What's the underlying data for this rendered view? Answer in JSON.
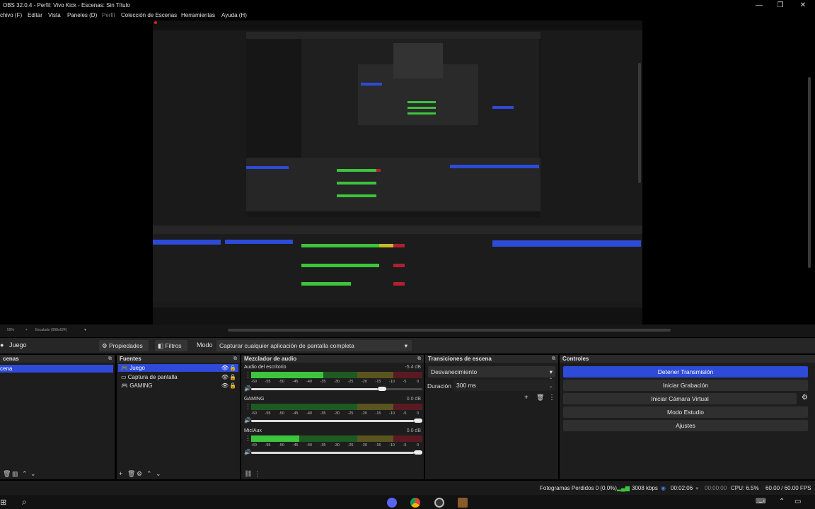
{
  "window": {
    "title": "OBS 32.0.4 - Perfil: Vivo Kick - Escenas: Sin Título",
    "minimize": "—",
    "maximize": "❐",
    "close": "✕"
  },
  "menu": {
    "items": [
      "chivo (F)",
      "Editar",
      "Vista",
      "Paneles (D)",
      "Perfil",
      "Colección de Escenas",
      "Herramientas",
      "Ayuda (H)"
    ]
  },
  "preview_bar": {
    "zoom": "59%",
    "scale": "Escalado (998x624)"
  },
  "context_bar": {
    "source_name": "Juego",
    "properties_label": "Propiedades",
    "filters_label": "Filtros",
    "mode_label": "Modo",
    "mode_value": "Capturar cualquier aplicación de pantalla completa"
  },
  "scenes": {
    "title": "cenas",
    "items": [
      {
        "label": "cena",
        "selected": true
      }
    ]
  },
  "sources": {
    "title": "Fuentes",
    "items": [
      {
        "label": "Juego",
        "icon": "gamepad-icon",
        "selected": true
      },
      {
        "label": "Captura de pantalla",
        "icon": "monitor-icon",
        "selected": false
      },
      {
        "label": "GAMING",
        "icon": "gamepad-icon",
        "selected": false
      }
    ]
  },
  "mixer": {
    "title": "Mezclador de audio",
    "ticks": [
      "-60",
      "-55",
      "-50",
      "-45",
      "-40",
      "-35",
      "-30",
      "-25",
      "-20",
      "-15",
      "-10",
      "-5",
      "0"
    ],
    "channels": [
      {
        "name": "Audio del escritorio",
        "db": "-5.4 dB",
        "level": 0.42,
        "volume": 0.78
      },
      {
        "name": "GAMING",
        "db": "0.0 dB",
        "level": 0.0,
        "volume": 1.0
      },
      {
        "name": "Mic/Aux",
        "db": "0.0 dB",
        "level": 0.28,
        "volume": 1.0
      }
    ]
  },
  "transitions": {
    "title": "Transiciones de escena",
    "selected": "Desvanecimiento",
    "duration_label": "Duración",
    "duration_value": "300 ms"
  },
  "controls": {
    "title": "Controles",
    "buttons": [
      {
        "label": "Detener Transmisión",
        "active": true
      },
      {
        "label": "Iniciar Grabación",
        "active": false
      },
      {
        "label": "Iniciar Cámara Virtual",
        "active": false
      },
      {
        "label": "Modo Estudio",
        "active": false
      },
      {
        "label": "Ajustes",
        "active": false
      }
    ]
  },
  "status": {
    "dropped_frames": "Fotogramas Perdidos 0 (0.0%)",
    "bitrate": "3008 kbps",
    "stream_time": "00:02:06",
    "rec_time": "00:00:00",
    "cpu": "CPU: 6.5%",
    "fps": "60.00 / 60.00 FPS"
  },
  "colors": {
    "accent": "#2d4bd8",
    "meter_green": "#3dc43d",
    "meter_yellow": "#c8b82a",
    "meter_red": "#b02030"
  }
}
